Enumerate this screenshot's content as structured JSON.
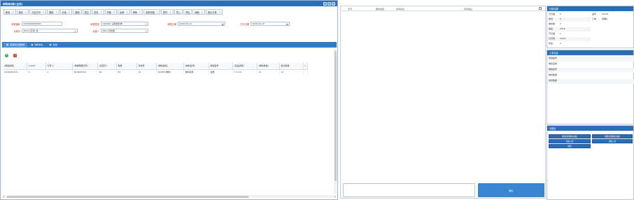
{
  "left": {
    "title": "串联码扫描 [主页]",
    "window_buttons": [
      "▫",
      "▭",
      "✕"
    ],
    "toolbar": [
      {
        "label": "新增",
        "dd": "×"
      },
      {
        "label": "保存",
        "dd": "×"
      },
      {
        "label": "分页打印",
        "dd": "×"
      },
      {
        "label": "删除",
        "dd": "×"
      },
      {
        "label": "清单",
        "dd": "×"
      },
      {
        "label": "撤销",
        "dd": ""
      },
      {
        "label": "提交",
        "dd": ""
      },
      {
        "label": "任务",
        "dd": "×"
      },
      {
        "label": "作废",
        "dd": "×"
      },
      {
        "label": "反审",
        "dd": "×"
      },
      {
        "label": "审核",
        "dd": "×"
      },
      {
        "label": "查看流程",
        "dd": "×"
      },
      {
        "label": "附件",
        "dd": "×"
      },
      {
        "label": "导入",
        "dd": ""
      },
      {
        "label": "导出",
        "dd": ""
      },
      {
        "label": "刷新",
        "dd": "×"
      },
      {
        "label": "报价分录",
        "dd": "×"
      }
    ],
    "form": {
      "doc_no_label": "单据编码",
      "doc_no_value": "DYD2016040001",
      "doc_type_label": "单据类型",
      "doc_type_value": "CJLX001 采购收料单",
      "doc_date_label": "单据日期",
      "doc_date_value": "2016-04-14",
      "print_date_label": "打印日期",
      "print_date_value": "2016-04-15",
      "warehouse_label": "仓库名",
      "warehouse_value": "0001 (东莞) 仓",
      "user_label": "创建人",
      "user_value": "P001 孙嘉荣"
    },
    "tabs": [
      {
        "label": "串联码扫描明细",
        "icon": "▦"
      },
      {
        "label": "物料信息",
        "icon": "▦"
      },
      {
        "label": "其他",
        "icon": "▦"
      }
    ],
    "table": {
      "columns": [
        "(串联编码)",
        "(1/0/4)",
        "行号 ↕",
        "(单据明细序号)",
        "(来源行)",
        "数量",
        "仓储号",
        "(物料编码)",
        "(物料名称)",
        "规格型号",
        "(实品类型)",
        "(物料数量)",
        "批次数量",
        "("
      ],
      "rows": [
        [
          "2016041415...",
          "1",
          "1",
          "201604150",
          "16",
          "63",
          "15",
          "62038 (物料)",
          "物料名称",
          "金属",
          "7.7.2.5",
          "11",
          "11",
          ""
        ]
      ]
    },
    "hscroll_left": "◂",
    "hscroll_right": "▸"
  },
  "mid": {
    "columns": [
      "序号",
      "物料类型",
      "条码信息",
      "条码信息"
    ],
    "check": "✓",
    "scan_placeholder": "",
    "confirm_label": "确认"
  },
  "right": {
    "panel1": {
      "title": "扫描结果",
      "items": [
        {
          "k": "已扫描",
          "v": "0"
        },
        {
          "k": "未扫",
          "v": "0"
        },
        {
          "k": "剩余数",
          "v": "1"
        },
        {
          "k": "成品",
          "v": "2016"
        },
        {
          "k": "可扫描",
          "v": "1"
        },
        {
          "k": "已扫码",
          "v": "100%"
        },
        {
          "k": "状态",
          "v": "0"
        }
      ],
      "right_items": [
        {
          "k": "品号",
          "v": "51031"
        },
        {
          "k": "工单",
          "v": "未确认"
        }
      ]
    },
    "panel2": {
      "title": "工单信息",
      "items": [
        "条码编号",
        "物料名称",
        "规格型号",
        "物料数量",
        "批次数量"
      ]
    },
    "panel3": {
      "title": "功能区",
      "buttons": [
        "批量扫码确认成品",
        "批量扫码确认成品",
        "扫描入库",
        "清除入库",
        "撤回"
      ]
    }
  }
}
